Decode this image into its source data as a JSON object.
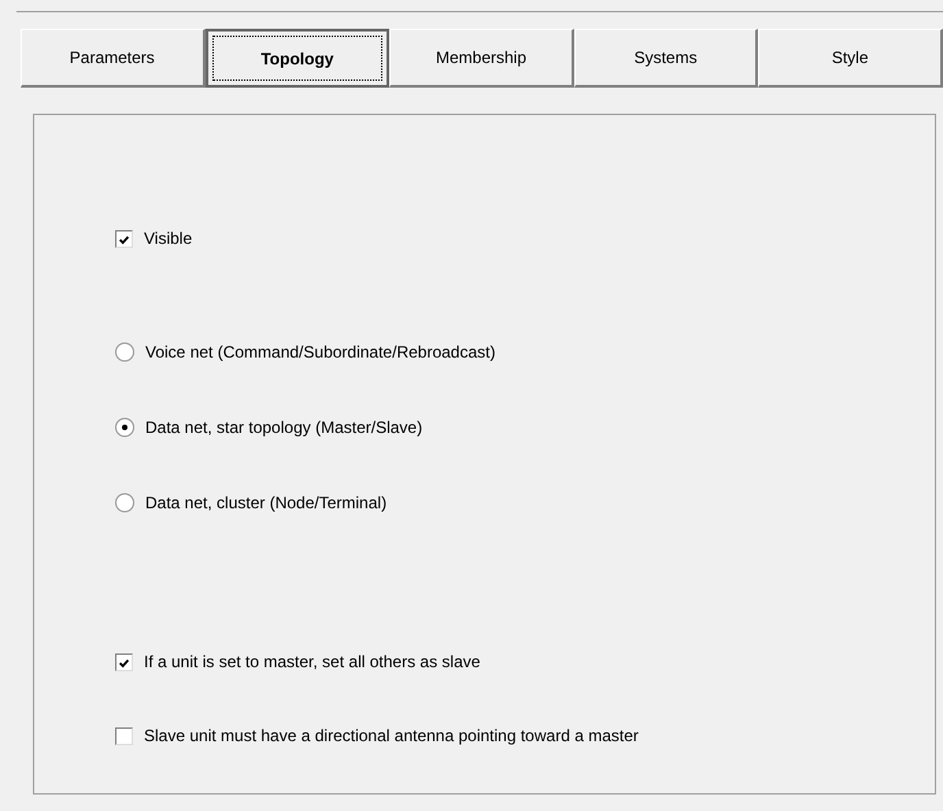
{
  "tabs": [
    {
      "label": "Parameters",
      "selected": false
    },
    {
      "label": "Topology",
      "selected": true
    },
    {
      "label": "Membership",
      "selected": false
    },
    {
      "label": "Systems",
      "selected": false
    },
    {
      "label": "Style",
      "selected": false
    }
  ],
  "options": [
    {
      "kind": "checkbox",
      "label": "Visible",
      "checked": true
    },
    {
      "kind": "radio",
      "label": "Voice net (Command/Subordinate/Rebroadcast)",
      "selected": false
    },
    {
      "kind": "radio",
      "label": "Data net, star topology (Master/Slave)",
      "selected": true
    },
    {
      "kind": "radio",
      "label": "Data net, cluster (Node/Terminal)",
      "selected": false
    },
    {
      "kind": "checkbox",
      "label": "If a unit is set to master, set all others as slave",
      "checked": true
    },
    {
      "kind": "checkbox",
      "label": "Slave unit must have a directional antenna pointing toward a master",
      "checked": false
    }
  ]
}
